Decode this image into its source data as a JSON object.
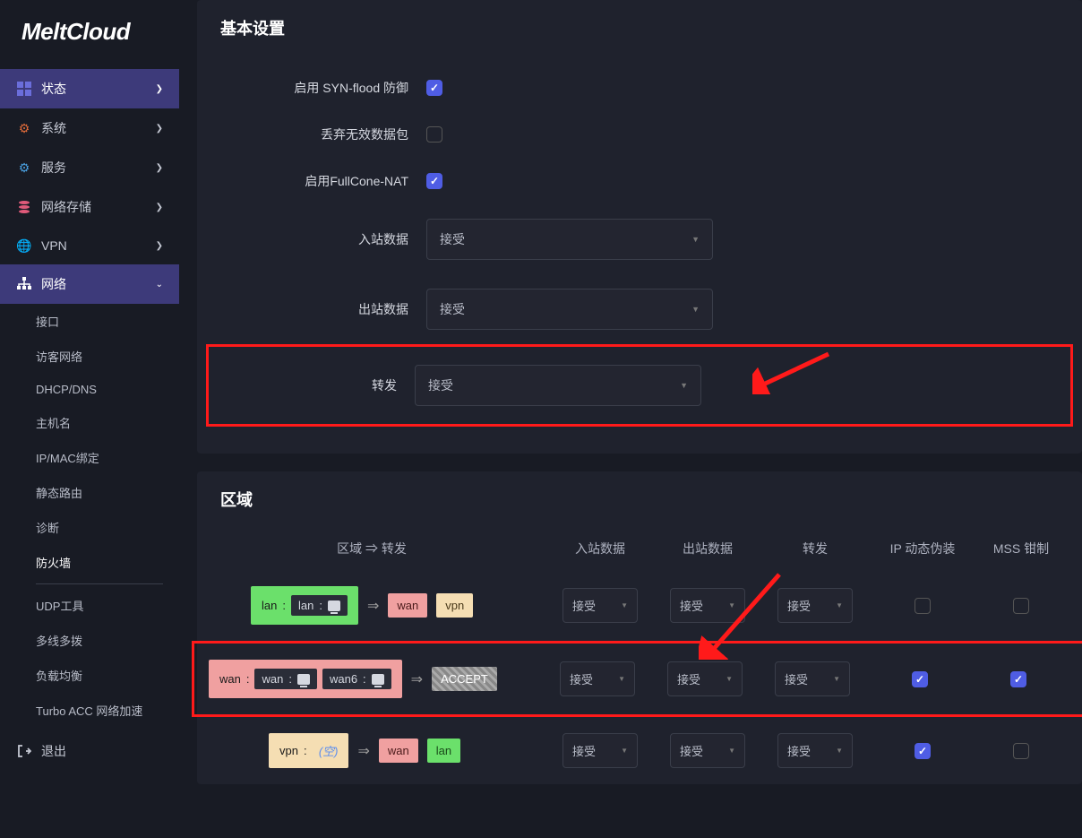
{
  "brand": "MeltCloud",
  "sidebar": {
    "items": [
      {
        "label": "状态",
        "icon": "grid"
      },
      {
        "label": "系统",
        "icon": "gear"
      },
      {
        "label": "服务",
        "icon": "gears"
      },
      {
        "label": "网络存储",
        "icon": "db"
      },
      {
        "label": "VPN",
        "icon": "globe"
      },
      {
        "label": "网络",
        "icon": "net"
      }
    ],
    "subitems": [
      {
        "label": "接口"
      },
      {
        "label": "访客网络"
      },
      {
        "label": "DHCP/DNS"
      },
      {
        "label": "主机名"
      },
      {
        "label": "IP/MAC绑定"
      },
      {
        "label": "静态路由"
      },
      {
        "label": "诊断"
      },
      {
        "label": "防火墙"
      },
      {
        "label": "UDP工具"
      },
      {
        "label": "多线多拨"
      },
      {
        "label": "负载均衡"
      },
      {
        "label": "Turbo ACC 网络加速"
      }
    ],
    "logout": "退出"
  },
  "basic": {
    "title": "基本设置",
    "syn_label": "启用 SYN-flood 防御",
    "syn_checked": true,
    "drop_label": "丢弃无效数据包",
    "drop_checked": false,
    "fullcone_label": "启用FullCone-NAT",
    "fullcone_checked": true,
    "inbound_label": "入站数据",
    "inbound_value": "接受",
    "outbound_label": "出站数据",
    "outbound_value": "接受",
    "forward_label": "转发",
    "forward_value": "接受"
  },
  "zones": {
    "title": "区域",
    "headers": {
      "flow": "区域 ⇒ 转发",
      "in": "入站数据",
      "out": "出站数据",
      "fwd": "转发",
      "masq": "IP 动态伪装",
      "mss": "MSS 钳制"
    },
    "accept": "接受",
    "rows": [
      {
        "name": "lan",
        "ifaces": [
          "lan"
        ],
        "targets": [
          "wan",
          "vpn"
        ],
        "masq": false,
        "mss": false,
        "color": "lan"
      },
      {
        "name": "wan",
        "ifaces": [
          "wan",
          "wan6"
        ],
        "targets_accept": "ACCEPT",
        "masq": true,
        "mss": true,
        "color": "wan"
      },
      {
        "name": "vpn",
        "ifaces_empty": "(空)",
        "targets": [
          "wan",
          "lan"
        ],
        "masq": true,
        "mss": false,
        "color": "vpn"
      }
    ]
  }
}
